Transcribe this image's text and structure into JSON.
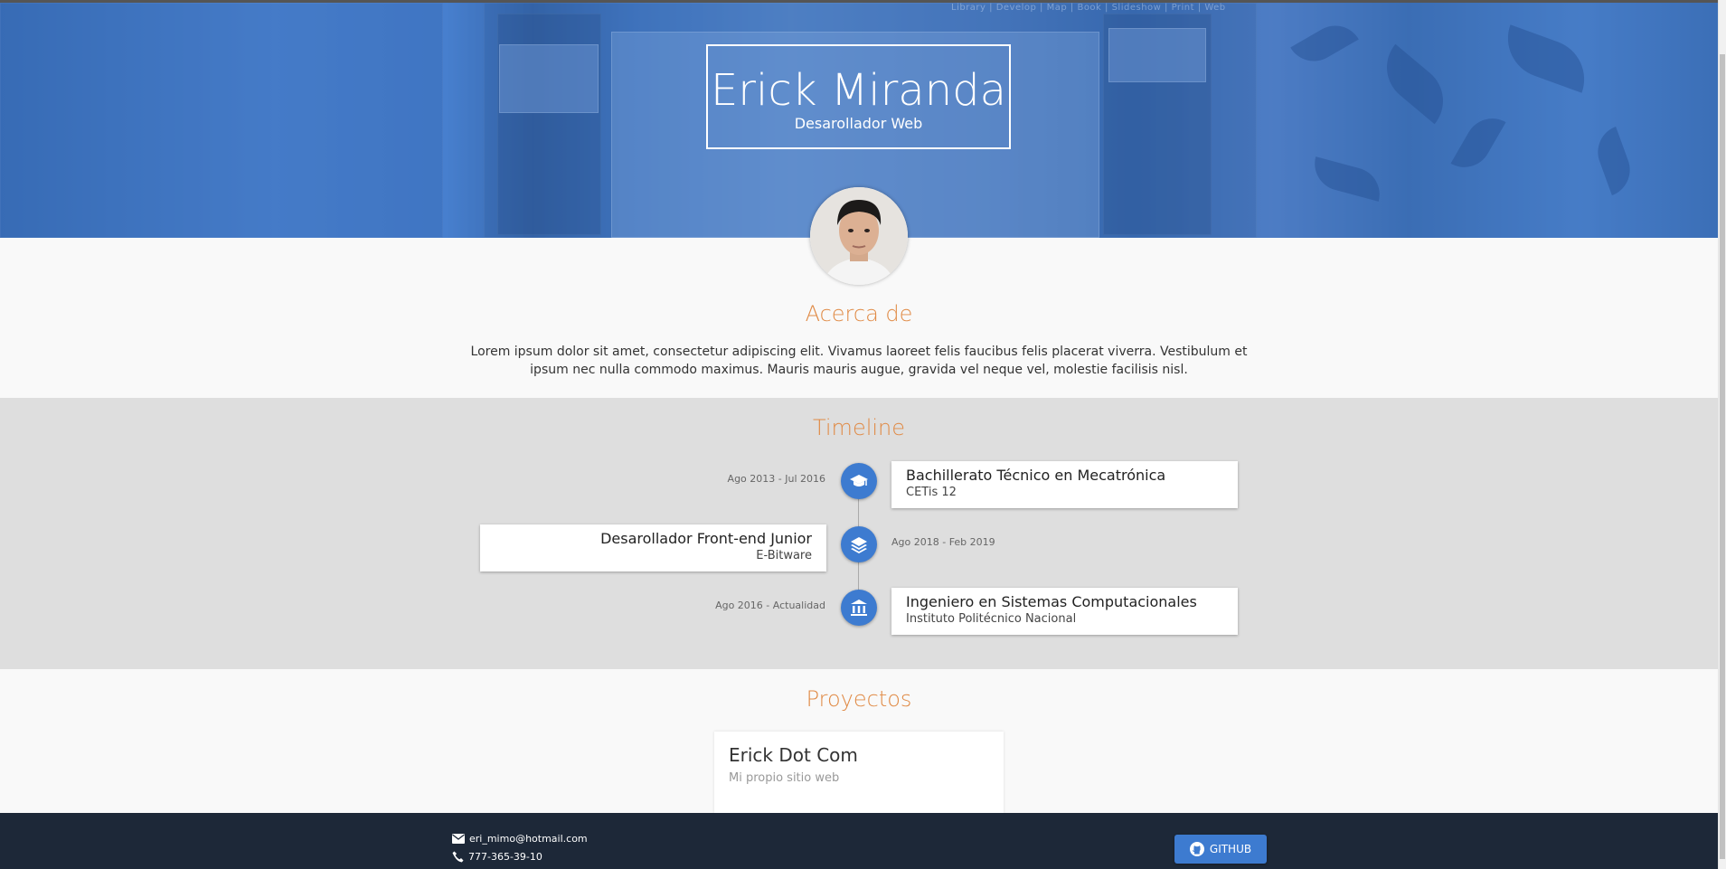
{
  "header": {
    "name": "Erick Miranda",
    "role": "Desarollador Web",
    "background_menu": [
      "Library",
      "Develop",
      "Map",
      "Book",
      "Slideshow",
      "Print",
      "Web"
    ]
  },
  "about": {
    "title": "Acerca de",
    "text": "Lorem ipsum dolor sit amet, consectetur adipiscing elit. Vivamus laoreet felis faucibus felis placerat viverra. Vestibulum et ipsum nec nulla commodo maximus. Mauris mauris augue, gravida vel neque vel, molestie facilisis nisl."
  },
  "timeline": {
    "title": "Timeline",
    "items": [
      {
        "date": "Ago 2013 - Jul 2016",
        "title": "Bachillerato Técnico en Mecatrónica",
        "subtitle": "CETis 12",
        "icon": "graduation-cap-icon"
      },
      {
        "date": "Ago 2018 - Feb 2019",
        "title": "Desarollador Front-end Junior",
        "subtitle": "E-Bitware",
        "icon": "layers-icon"
      },
      {
        "date": "Ago 2016 - Actualidad",
        "title": "Ingeniero en Sistemas Computacionales",
        "subtitle": "Instituto Politécnico Nacional",
        "icon": "university-icon"
      }
    ]
  },
  "projects": {
    "title": "Proyectos",
    "items": [
      {
        "name": "Erick Dot Com",
        "description": "Mi propio sitio web"
      }
    ]
  },
  "footer": {
    "email": "eri_mimo@hotmail.com",
    "phone": "777-365-39-10",
    "github_label": "GITHUB"
  },
  "colors": {
    "accent": "#e08a45",
    "primary": "#3d7bd0",
    "footer_bg": "#1d2838",
    "timeline_bg": "#dedede"
  }
}
